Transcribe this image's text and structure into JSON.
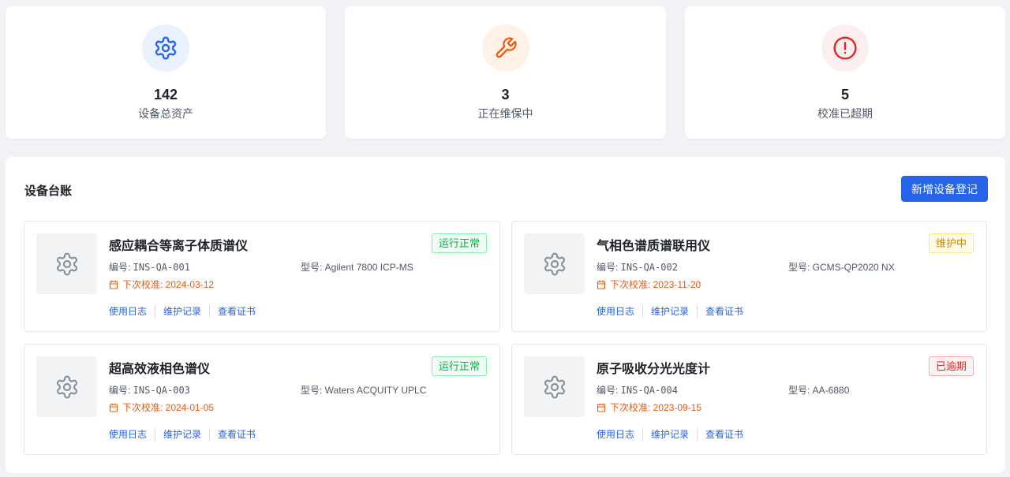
{
  "stats": [
    {
      "value": "142",
      "label": "设备总资产",
      "icon": "gear-icon",
      "color": "#2563eb",
      "bg": "#eaf1fe"
    },
    {
      "value": "3",
      "label": "正在维保中",
      "icon": "wrench-icon",
      "color": "#ea580c",
      "bg": "#fff1e6"
    },
    {
      "value": "5",
      "label": "校准已超期",
      "icon": "alert-circle-icon",
      "color": "#dc2626",
      "bg": "#fdeeee"
    }
  ],
  "ledger": {
    "title": "设备台账",
    "add_button": "新增设备登记",
    "items": [
      {
        "name": "感应耦合等离子体质谱仪",
        "status": "运行正常",
        "status_type": "ok",
        "code_label": "编号: ",
        "code": "INS-QA-001",
        "model": "型号: Agilent 7800 ICP-MS",
        "calibration": "下次校准: 2024-03-12"
      },
      {
        "name": "气相色谱质谱联用仪",
        "status": "维护中",
        "status_type": "warn",
        "code_label": "编号: ",
        "code": "INS-QA-002",
        "model": "型号: GCMS-QP2020 NX",
        "calibration": "下次校准: 2023-11-20"
      },
      {
        "name": "超高效液相色谱仪",
        "status": "运行正常",
        "status_type": "ok",
        "code_label": "编号: ",
        "code": "INS-QA-003",
        "model": "型号: Waters ACQUITY UPLC",
        "calibration": "下次校准: 2024-01-05"
      },
      {
        "name": "原子吸收分光光度计",
        "status": "已逾期",
        "status_type": "bad",
        "code_label": "编号: ",
        "code": "INS-QA-004",
        "model": "型号: AA-6880",
        "calibration": "下次校准: 2023-09-15"
      }
    ],
    "actions": [
      "使用日志",
      "维护记录",
      "查看证书"
    ]
  }
}
